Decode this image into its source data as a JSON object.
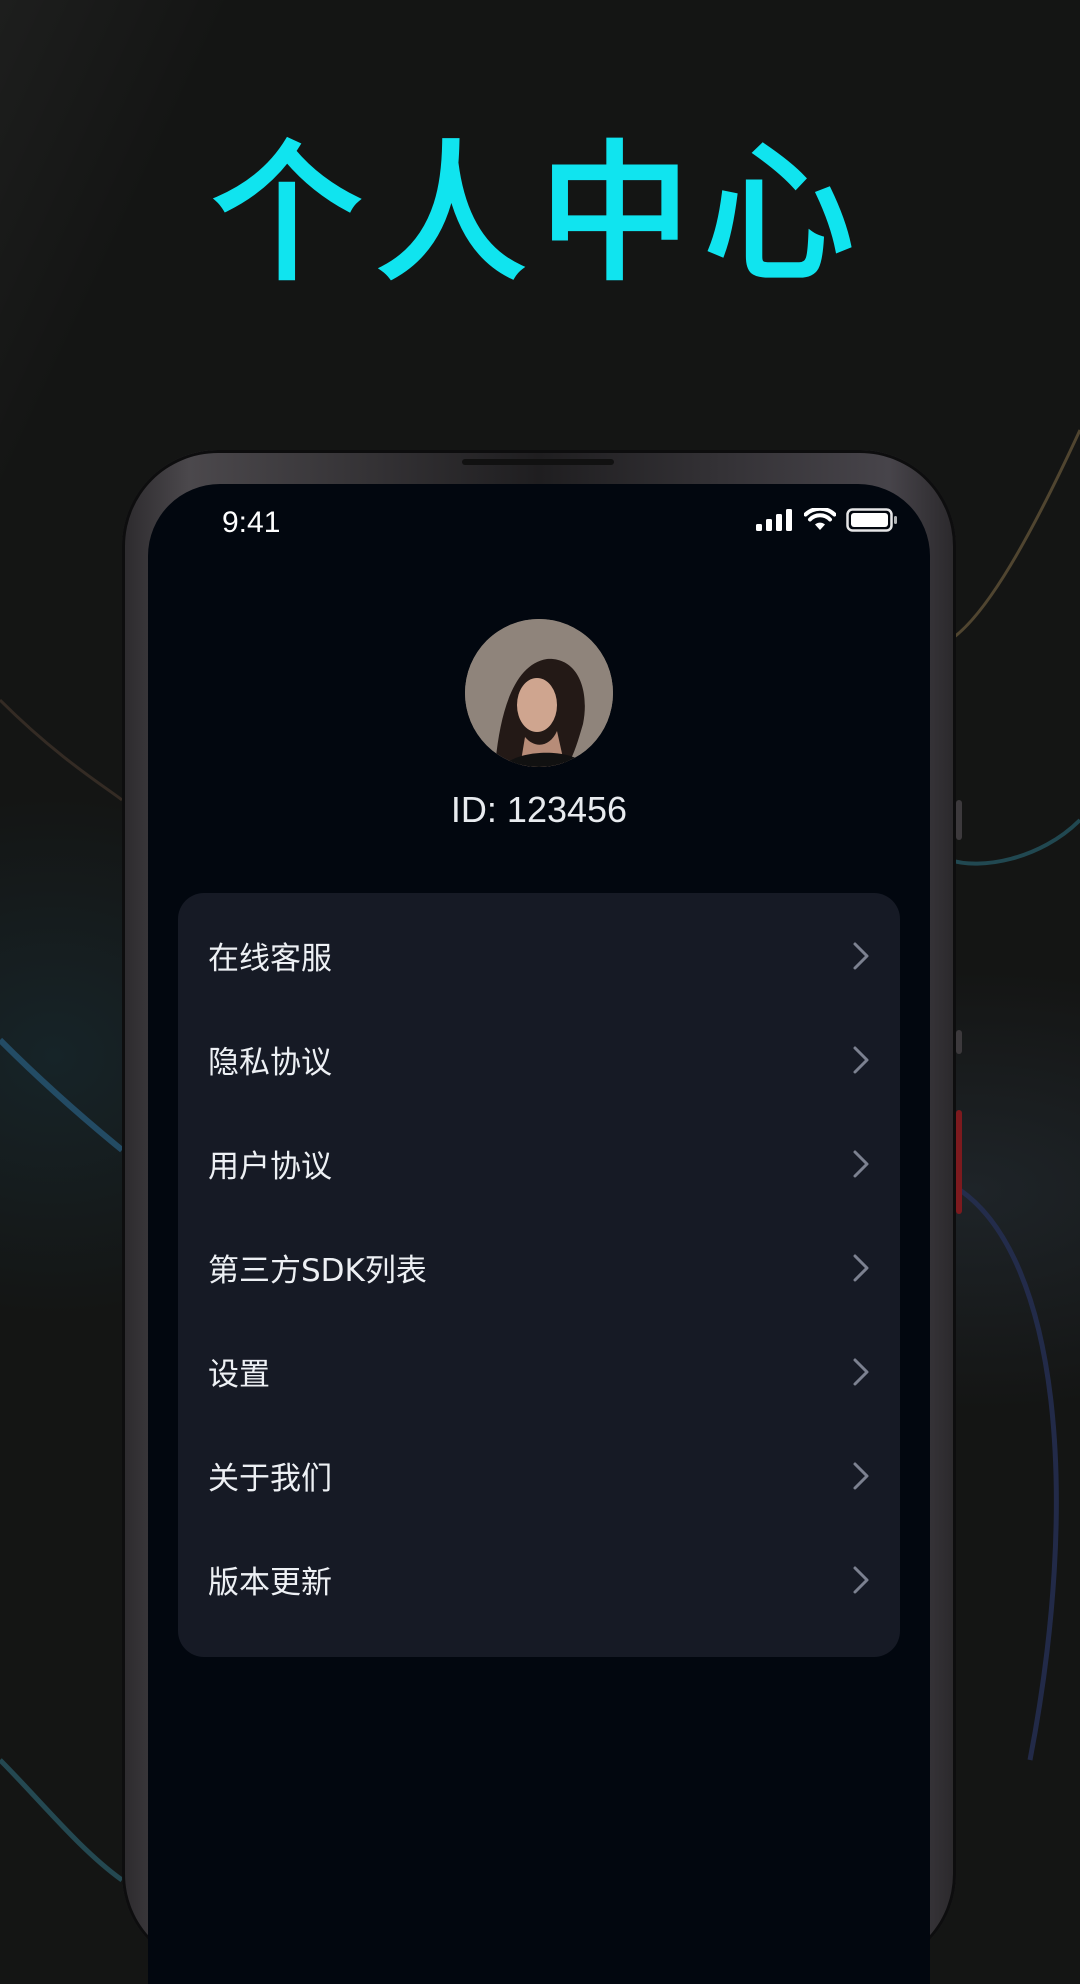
{
  "headline": "个人中心",
  "status_bar": {
    "time": "9:41"
  },
  "profile": {
    "id_text": "ID: 123456"
  },
  "menu": {
    "items": [
      {
        "label": "在线客服"
      },
      {
        "label": "隐私协议"
      },
      {
        "label": "用户协议"
      },
      {
        "label": "第三方SDK列表"
      },
      {
        "label": "设置"
      },
      {
        "label": "关于我们"
      },
      {
        "label": "版本更新"
      }
    ]
  },
  "colors": {
    "headline": "#10e4ef",
    "page_background": "#141514",
    "screen_background": "#02070f",
    "card_background": "#161a25"
  },
  "icons": [
    "signal-icon",
    "wifi-icon",
    "battery-icon",
    "chevron-right-icon"
  ]
}
